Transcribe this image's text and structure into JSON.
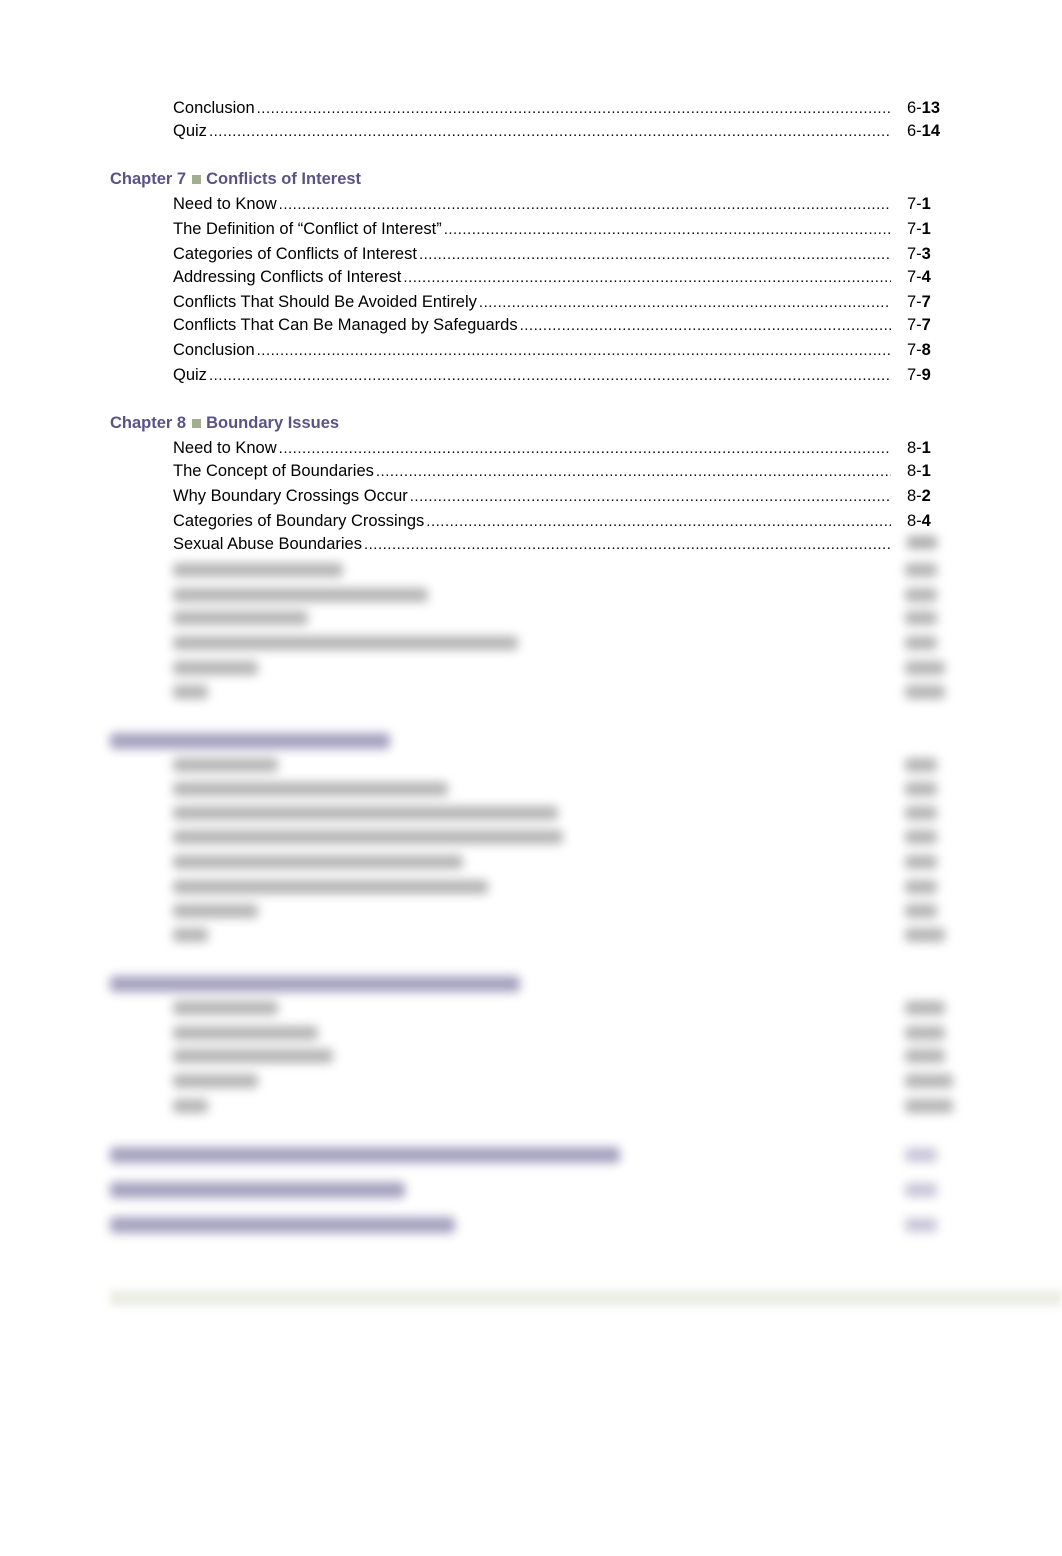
{
  "document": {
    "type": "table-of-contents",
    "visible_sections": [
      {
        "heading": null,
        "entries": [
          {
            "label": "Conclusion",
            "page_prefix": "6-",
            "page_num": "13"
          },
          {
            "label": "Quiz",
            "page_prefix": "6-",
            "page_num": "14"
          }
        ]
      },
      {
        "heading": {
          "chapter": "Chapter 7",
          "title": "Conflicts of Interest"
        },
        "entries": [
          {
            "label": "Need to Know",
            "page_prefix": "7-",
            "page_num": "1"
          },
          {
            "label": "The Definition of “Conflict of Interest”",
            "page_prefix": "7-",
            "page_num": "1"
          },
          {
            "label": "Categories of Conflicts of Interest",
            "page_prefix": "7-",
            "page_num": "3"
          },
          {
            "label": "Addressing Conflicts of Interest",
            "page_prefix": "7-",
            "page_num": "4"
          },
          {
            "label": "Conflicts That Should Be Avoided Entirely",
            "page_prefix": "7-",
            "page_num": "7"
          },
          {
            "label": "Conflicts That Can Be Managed by Safeguards",
            "page_prefix": "7-",
            "page_num": "7"
          },
          {
            "label": "Conclusion",
            "page_prefix": "7-",
            "page_num": "8"
          },
          {
            "label": "Quiz",
            "page_prefix": "7-",
            "page_num": "9"
          }
        ]
      },
      {
        "heading": {
          "chapter": "Chapter 8",
          "title": "Boundary Issues"
        },
        "entries": [
          {
            "label": "Need to Know",
            "page_prefix": "8-",
            "page_num": "1"
          },
          {
            "label": "The Concept of Boundaries",
            "page_prefix": "8-",
            "page_num": "1"
          },
          {
            "label": "Why Boundary Crossings Occur",
            "page_prefix": "8-",
            "page_num": "2"
          },
          {
            "label": "Categories of Boundary Crossings",
            "page_prefix": "8-",
            "page_num": "4"
          },
          {
            "label": "Sexual Abuse Boundaries",
            "page_prefix": "",
            "page_num": ""
          }
        ]
      }
    ],
    "obscured_region": {
      "note": "remaining content is blurred and unreadable",
      "obscured_entry_rows": 6,
      "obscured_sections": [
        {
          "kind": "chapter",
          "rows": 8
        },
        {
          "kind": "chapter",
          "rows": 5
        }
      ],
      "obscured_appendix_rows": 3
    }
  },
  "colors": {
    "heading": "#5a5388",
    "heading_bullet": "#a3ad90",
    "text": "#000000"
  }
}
